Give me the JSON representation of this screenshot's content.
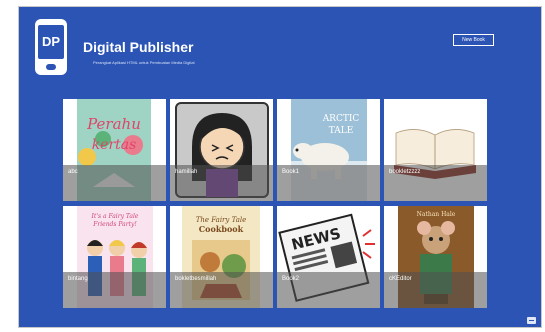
{
  "app": {
    "logo_text": "DP",
    "title": "Digital Publisher",
    "subtitle": "Perangkat Aplikasi HTML untuk Pembuatan Media Digital"
  },
  "toolbar": {
    "new_book_label": "New Book"
  },
  "books": [
    {
      "label": "abc",
      "cover_text": "Perahu kertas",
      "cover_icon": "perahu-kertas-cover"
    },
    {
      "label": "hamillah",
      "cover_icon": "cartoon-girl-cover"
    },
    {
      "label": "Book1",
      "cover_text": "ARCTIC TALE",
      "cover_icon": "polar-bear-cover"
    },
    {
      "label": "bookletzzzz",
      "cover_icon": "open-book-cover"
    },
    {
      "label": "bintang",
      "cover_text": "It's a Fairy Tale Friends Party!",
      "cover_icon": "princesses-cover"
    },
    {
      "label": "bokletbesmillah",
      "cover_text": "The Fairy Tale Cookbook",
      "cover_icon": "fairy-tale-cookbook-cover"
    },
    {
      "label": "Book2",
      "cover_text": "NEWS",
      "cover_icon": "newspaper-cover"
    },
    {
      "label": "cKEditor",
      "cover_text": "Nathan Hale",
      "cover_icon": "mouse-adventure-cover"
    }
  ],
  "colors": {
    "background": "#2b54b5",
    "tile_bar": "#505050"
  }
}
